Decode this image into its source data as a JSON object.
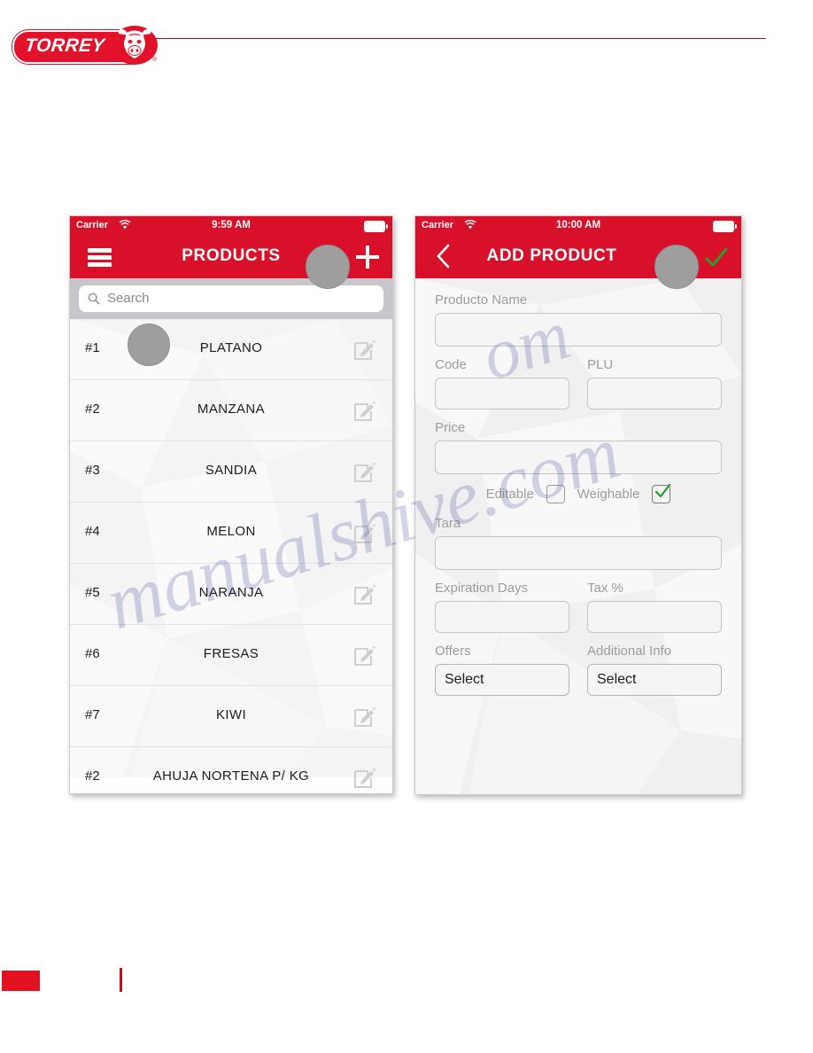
{
  "brand": {
    "wordmark": "TORREY",
    "registered_mark": "®",
    "bull_icon": "bull-head-icon",
    "logo_color": "#e3112a",
    "rule_color": "#9e1b26"
  },
  "phones": {
    "left": {
      "status": {
        "carrier": "Carrier",
        "wifi_icon": "wifi-icon",
        "time": "9:59 AM",
        "battery_icon": "battery-full-icon"
      },
      "nav": {
        "menu_icon": "hamburger-menu-icon",
        "title": "PRODUCTS",
        "avatar": "user-avatar",
        "add_icon": "plus-icon"
      },
      "search": {
        "icon": "search-icon",
        "placeholder": "Search"
      },
      "list": {
        "edit_icon": "edit-pencil-icon",
        "rows": [
          {
            "index": "#1",
            "name": "PLATANO",
            "has_avatar": true
          },
          {
            "index": "#2",
            "name": "MANZANA",
            "has_avatar": false
          },
          {
            "index": "#3",
            "name": "SANDIA",
            "has_avatar": false
          },
          {
            "index": "#4",
            "name": "MELON",
            "has_avatar": false
          },
          {
            "index": "#5",
            "name": "NARANJA",
            "has_avatar": false
          },
          {
            "index": "#6",
            "name": "FRESAS",
            "has_avatar": false
          },
          {
            "index": "#7",
            "name": "KIWI",
            "has_avatar": false
          },
          {
            "index": "#2",
            "name": "AHUJA NORTENA P/ KG",
            "has_avatar": false
          }
        ]
      }
    },
    "right": {
      "status": {
        "carrier": "Carrier",
        "wifi_icon": "wifi-icon",
        "time": "10:00 AM",
        "battery_icon": "battery-full-icon"
      },
      "nav": {
        "back_icon": "chevron-left-icon",
        "title": "ADD PRODUCT",
        "avatar": "user-avatar",
        "confirm_icon": "checkmark-icon",
        "confirm_color": "#2a9e2a"
      },
      "form": {
        "product_name_label": "Producto Name",
        "product_name_value": "",
        "code_label": "Code",
        "code_value": "",
        "plu_label": "PLU",
        "plu_value": "",
        "price_label": "Price",
        "price_value": "",
        "editable_label": "Editable",
        "editable_checked": false,
        "weighable_label": "Weighable",
        "weighable_checked": true,
        "tara_label": "Tara",
        "tara_value": "",
        "expiration_label": "Expiration Days",
        "expiration_value": "",
        "tax_label": "Tax %",
        "tax_value": "",
        "offers_label": "Offers",
        "offers_value": "Select",
        "additional_info_label": "Additional Info",
        "additional_info_value": "Select"
      }
    }
  },
  "watermark": {
    "line1": "manualshive.com",
    "line2": "om"
  },
  "footer": {
    "block_color": "#e3101f",
    "bar_color": "#c01020"
  }
}
